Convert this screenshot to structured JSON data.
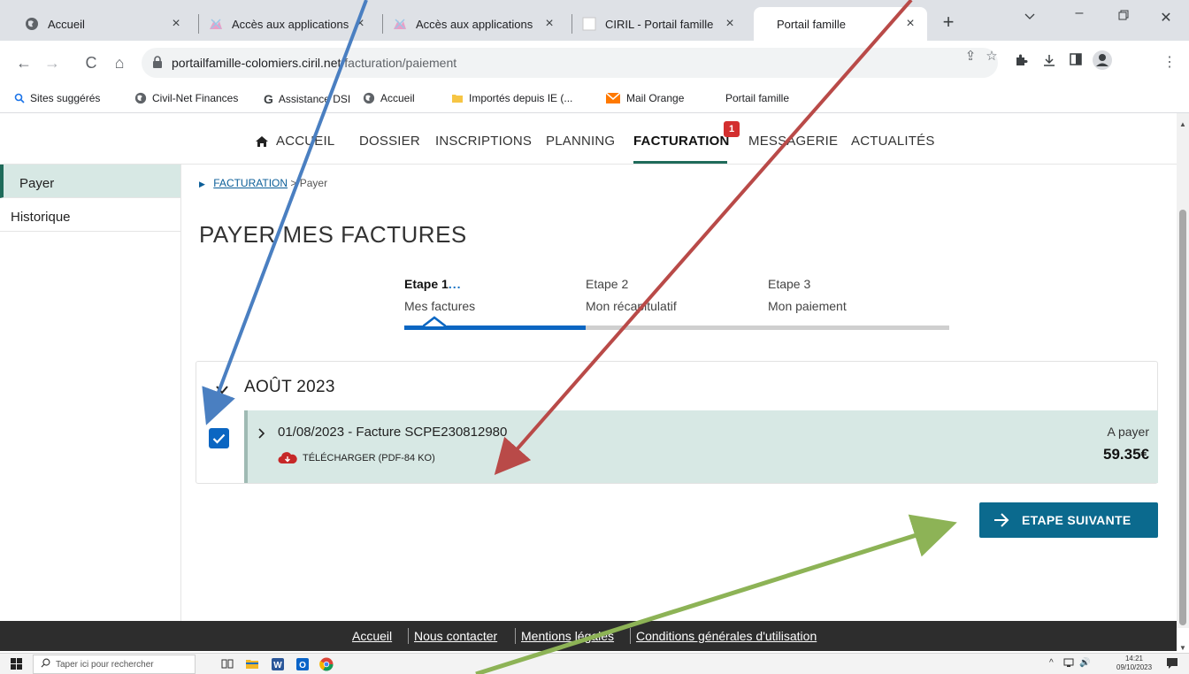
{
  "browser": {
    "tabs": [
      {
        "title": "Accueil"
      },
      {
        "title": "Accès aux applications"
      },
      {
        "title": "Accès aux applications"
      },
      {
        "title": "CIRIL - Portail famille"
      },
      {
        "title": "Portail famille"
      }
    ],
    "url_host": "portailfamille-colomiers.ciril.net",
    "url_path": "/facturation/paiement",
    "bookmarks": [
      {
        "label": "Sites suggérés"
      },
      {
        "label": "Civil-Net Finances"
      },
      {
        "label": "Assistance DSI"
      },
      {
        "label": "Accueil"
      },
      {
        "label": "Importés depuis IE (..."
      },
      {
        "label": "Mail Orange"
      },
      {
        "label": "Portail famille"
      }
    ]
  },
  "nav": {
    "items": [
      {
        "label": "ACCUEIL"
      },
      {
        "label": "DOSSIER"
      },
      {
        "label": "INSCRIPTIONS"
      },
      {
        "label": "PLANNING"
      },
      {
        "label": "FACTURATION"
      },
      {
        "label": "MESSAGERIE"
      },
      {
        "label": "ACTUALITÉS"
      }
    ],
    "active": "FACTURATION",
    "badge": "1"
  },
  "sidebar": {
    "items": [
      {
        "label": "Payer"
      },
      {
        "label": "Historique"
      }
    ]
  },
  "breadcrumb": {
    "link": "FACTURATION",
    "current": "> Payer"
  },
  "page": {
    "title": "PAYER MES FACTURES"
  },
  "steps": [
    {
      "label": "Etape 1",
      "dots": "...",
      "sub": "Mes factures"
    },
    {
      "label": "Etape 2",
      "sub": "Mon récapitulatif"
    },
    {
      "label": "Etape 3",
      "sub": "Mon paiement"
    }
  ],
  "progress": {
    "current_step": 1,
    "total_steps": 3
  },
  "invoices": {
    "month": "AOÛT 2023",
    "row": {
      "title": "01/08/2023 - Facture SCPE230812980",
      "download": "TÉLÉCHARGER (PDF-84 KO)",
      "status": "A payer",
      "amount": "59.35€",
      "checked": true
    }
  },
  "actions": {
    "next_label": "ETAPE SUIVANTE"
  },
  "footer": {
    "links": [
      {
        "label": "Accueil"
      },
      {
        "label": "Nous contacter"
      },
      {
        "label": "Mentions légales"
      },
      {
        "label": "Conditions générales d'utilisation"
      }
    ]
  },
  "taskbar": {
    "search_placeholder": "Taper ici pour rechercher",
    "time": "14:21",
    "date": "09/10/2023"
  },
  "colors": {
    "accent_green": "#1f6b5a",
    "primary_blue": "#0b66c2",
    "button_teal": "#0b6a8e",
    "row_bg": "#d7e8e4",
    "badge_red": "#d32f2f",
    "arrow_blue": "#4a7fc1",
    "arrow_red": "#b94a48",
    "arrow_green": "#8db356"
  }
}
